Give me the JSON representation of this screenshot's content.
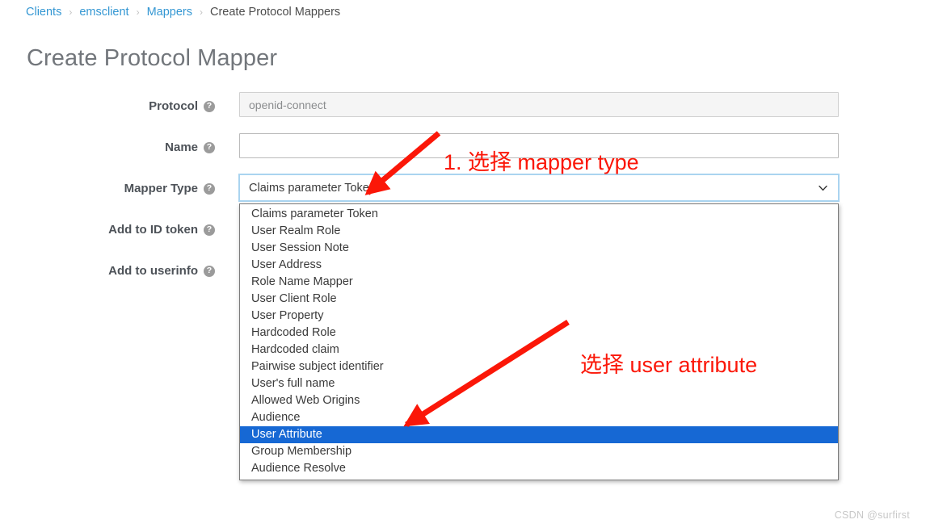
{
  "breadcrumb": {
    "separator": "›",
    "items": [
      {
        "label": "Clients",
        "link": true
      },
      {
        "label": "emsclient",
        "link": true
      },
      {
        "label": "Mappers",
        "link": true
      },
      {
        "label": "Create Protocol Mappers",
        "link": false
      }
    ]
  },
  "page": {
    "title": "Create Protocol Mapper"
  },
  "form": {
    "help_glyph": "?",
    "rows": [
      {
        "label": "Protocol",
        "field_type": "text",
        "value": "openid-connect",
        "placeholder": "",
        "disabled": true
      },
      {
        "label": "Name",
        "field_type": "text",
        "value": "",
        "placeholder": "",
        "disabled": false
      },
      {
        "label": "Mapper Type",
        "field_type": "select",
        "value": "Claims parameter Token",
        "disabled": false
      },
      {
        "label": "Add to ID token",
        "field_type": "toggle",
        "value": "",
        "disabled": false
      },
      {
        "label": "Add to userinfo",
        "field_type": "toggle",
        "value": "",
        "disabled": false
      }
    ]
  },
  "mapper_type_select": {
    "selected_display": "Claims parameter Token",
    "expanded": true,
    "highlighted_option": "User Attribute",
    "highlight_color": "#1668d4",
    "options": [
      "Claims parameter Token",
      "User Realm Role",
      "User Session Note",
      "User Address",
      "Role Name Mapper",
      "User Client Role",
      "User Property",
      "Hardcoded Role",
      "Hardcoded claim",
      "Pairwise subject identifier",
      "User's full name",
      "Allowed Web Origins",
      "Audience",
      "User Attribute",
      "Group Membership",
      "Audience Resolve"
    ]
  },
  "annotations": {
    "color": "#fb1708",
    "items": [
      {
        "text": "1. 选择 mapper type"
      },
      {
        "text": "选择 user attribute"
      }
    ]
  },
  "watermark": {
    "text": "CSDN @surfirst"
  },
  "colors": {
    "breadcrumb_link": "#3497d3",
    "page_title": "#72767b",
    "label": "#4d5258",
    "option_highlight": "#1668d4",
    "annotation_red": "#fb1708",
    "focus_ring": "#aad4f0"
  }
}
